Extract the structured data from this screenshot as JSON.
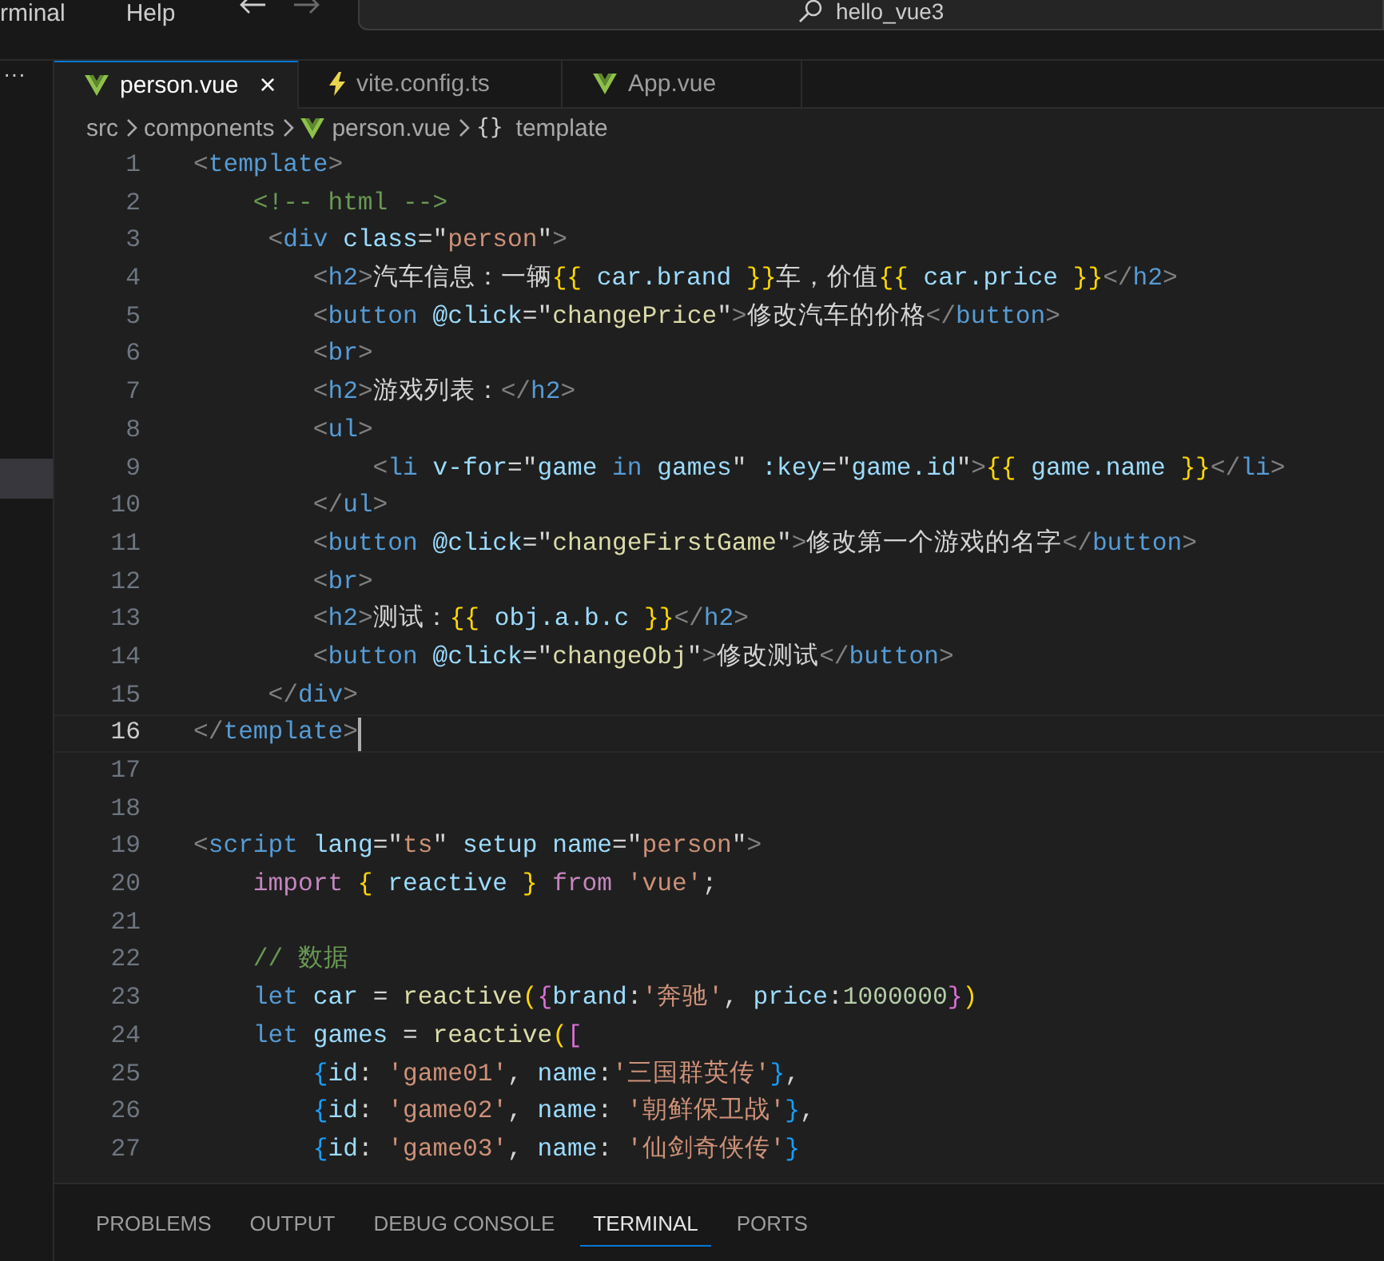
{
  "menu": [
    {
      "label": "rminal"
    },
    {
      "label": "Help"
    }
  ],
  "search": {
    "value": "hello_vue3"
  },
  "sidebar": {
    "more": "···"
  },
  "tabs": [
    {
      "label": "person.vue",
      "kind": "vue",
      "selected": true,
      "close": "×"
    },
    {
      "label": "vite.config.ts",
      "kind": "config",
      "selected": false
    },
    {
      "label": "App.vue",
      "kind": "vue",
      "selected": false
    }
  ],
  "breadcrumb": [
    {
      "label": "src"
    },
    {
      "label": "components"
    },
    {
      "label": "person.vue",
      "kind": "vue"
    },
    {
      "label": "template",
      "symbol": "{}"
    }
  ],
  "lines": [
    {
      "number": "1",
      "current": false,
      "tokens": [
        {
          "kind": "punct",
          "text": "<"
        },
        {
          "kind": "tag",
          "text": "template"
        },
        {
          "kind": "punct",
          "text": ">"
        }
      ]
    },
    {
      "number": "2",
      "current": false,
      "tokens": [
        {
          "kind": "comment",
          "text": "    <!-- html -->"
        }
      ]
    },
    {
      "number": "3",
      "current": false,
      "tokens": [
        {
          "kind": "punct",
          "text": "     <"
        },
        {
          "kind": "tag",
          "text": "div"
        },
        {
          "kind": "attr",
          "text": " class"
        },
        {
          "kind": "text",
          "text": "=\""
        },
        {
          "kind": "string",
          "text": "person"
        },
        {
          "kind": "text",
          "text": "\""
        },
        {
          "kind": "punct",
          "text": ">"
        }
      ]
    },
    {
      "number": "4",
      "current": false,
      "tokens": [
        {
          "kind": "punct",
          "text": "        <"
        },
        {
          "kind": "tag",
          "text": "h2"
        },
        {
          "kind": "punct",
          "text": ">"
        },
        {
          "kind": "text",
          "text": "汽车信息：一辆"
        },
        {
          "kind": "brace",
          "text": "{{"
        },
        {
          "kind": "var",
          "text": " car.brand "
        },
        {
          "kind": "brace",
          "text": "}}"
        },
        {
          "kind": "text",
          "text": "车，价值"
        },
        {
          "kind": "brace",
          "text": "{{"
        },
        {
          "kind": "var",
          "text": " car.price "
        },
        {
          "kind": "brace",
          "text": "}}"
        },
        {
          "kind": "punct",
          "text": "</"
        },
        {
          "kind": "tag",
          "text": "h2"
        },
        {
          "kind": "punct",
          "text": ">"
        }
      ]
    },
    {
      "number": "5",
      "current": false,
      "tokens": [
        {
          "kind": "punct",
          "text": "        <"
        },
        {
          "kind": "tag",
          "text": "button"
        },
        {
          "kind": "attr",
          "text": " @click"
        },
        {
          "kind": "text",
          "text": "=\""
        },
        {
          "kind": "function",
          "text": "changePrice"
        },
        {
          "kind": "text",
          "text": "\""
        },
        {
          "kind": "punct",
          "text": ">"
        },
        {
          "kind": "text",
          "text": "修改汽车的价格"
        },
        {
          "kind": "punct",
          "text": "</"
        },
        {
          "kind": "tag",
          "text": "button"
        },
        {
          "kind": "punct",
          "text": ">"
        }
      ]
    },
    {
      "number": "6",
      "current": false,
      "tokens": [
        {
          "kind": "punct",
          "text": "        <"
        },
        {
          "kind": "tag",
          "text": "br"
        },
        {
          "kind": "punct",
          "text": ">"
        }
      ]
    },
    {
      "number": "7",
      "current": false,
      "tokens": [
        {
          "kind": "punct",
          "text": "        <"
        },
        {
          "kind": "tag",
          "text": "h2"
        },
        {
          "kind": "punct",
          "text": ">"
        },
        {
          "kind": "text",
          "text": "游戏列表："
        },
        {
          "kind": "punct",
          "text": "</"
        },
        {
          "kind": "tag",
          "text": "h2"
        },
        {
          "kind": "punct",
          "text": ">"
        }
      ]
    },
    {
      "number": "8",
      "current": false,
      "tokens": [
        {
          "kind": "punct",
          "text": "        <"
        },
        {
          "kind": "tag",
          "text": "ul"
        },
        {
          "kind": "punct",
          "text": ">"
        }
      ]
    },
    {
      "number": "9",
      "current": false,
      "tokens": [
        {
          "kind": "punct",
          "text": "            <"
        },
        {
          "kind": "tag",
          "text": "li"
        },
        {
          "kind": "attr",
          "text": " v-for"
        },
        {
          "kind": "text",
          "text": "=\""
        },
        {
          "kind": "var",
          "text": "game "
        },
        {
          "kind": "tag",
          "text": "in"
        },
        {
          "kind": "var",
          "text": " games"
        },
        {
          "kind": "text",
          "text": "\""
        },
        {
          "kind": "attr",
          "text": " :key"
        },
        {
          "kind": "text",
          "text": "=\""
        },
        {
          "kind": "var",
          "text": "game.id"
        },
        {
          "kind": "text",
          "text": "\""
        },
        {
          "kind": "punct",
          "text": ">"
        },
        {
          "kind": "brace",
          "text": "{{"
        },
        {
          "kind": "var",
          "text": " game.name "
        },
        {
          "kind": "brace",
          "text": "}}"
        },
        {
          "kind": "punct",
          "text": "</"
        },
        {
          "kind": "tag",
          "text": "li"
        },
        {
          "kind": "punct",
          "text": ">"
        }
      ]
    },
    {
      "number": "10",
      "current": false,
      "tokens": [
        {
          "kind": "punct",
          "text": "        </"
        },
        {
          "kind": "tag",
          "text": "ul"
        },
        {
          "kind": "punct",
          "text": ">"
        }
      ]
    },
    {
      "number": "11",
      "current": false,
      "tokens": [
        {
          "kind": "punct",
          "text": "        <"
        },
        {
          "kind": "tag",
          "text": "button"
        },
        {
          "kind": "attr",
          "text": " @click"
        },
        {
          "kind": "text",
          "text": "=\""
        },
        {
          "kind": "function",
          "text": "changeFirstGame"
        },
        {
          "kind": "text",
          "text": "\""
        },
        {
          "kind": "punct",
          "text": ">"
        },
        {
          "kind": "text",
          "text": "修改第一个游戏的名字"
        },
        {
          "kind": "punct",
          "text": "</"
        },
        {
          "kind": "tag",
          "text": "button"
        },
        {
          "kind": "punct",
          "text": ">"
        }
      ]
    },
    {
      "number": "12",
      "current": false,
      "tokens": [
        {
          "kind": "punct",
          "text": "        <"
        },
        {
          "kind": "tag",
          "text": "br"
        },
        {
          "kind": "punct",
          "text": ">"
        }
      ]
    },
    {
      "number": "13",
      "current": false,
      "tokens": [
        {
          "kind": "punct",
          "text": "        <"
        },
        {
          "kind": "tag",
          "text": "h2"
        },
        {
          "kind": "punct",
          "text": ">"
        },
        {
          "kind": "text",
          "text": "测试："
        },
        {
          "kind": "brace",
          "text": "{{"
        },
        {
          "kind": "var",
          "text": " obj.a.b.c "
        },
        {
          "kind": "brace",
          "text": "}}"
        },
        {
          "kind": "punct",
          "text": "</"
        },
        {
          "kind": "tag",
          "text": "h2"
        },
        {
          "kind": "punct",
          "text": ">"
        }
      ]
    },
    {
      "number": "14",
      "current": false,
      "tokens": [
        {
          "kind": "punct",
          "text": "        <"
        },
        {
          "kind": "tag",
          "text": "button"
        },
        {
          "kind": "attr",
          "text": " @click"
        },
        {
          "kind": "text",
          "text": "=\""
        },
        {
          "kind": "function",
          "text": "changeObj"
        },
        {
          "kind": "text",
          "text": "\""
        },
        {
          "kind": "punct",
          "text": ">"
        },
        {
          "kind": "text",
          "text": "修改测试"
        },
        {
          "kind": "punct",
          "text": "</"
        },
        {
          "kind": "tag",
          "text": "button"
        },
        {
          "kind": "punct",
          "text": ">"
        }
      ]
    },
    {
      "number": "15",
      "current": false,
      "tokens": [
        {
          "kind": "punct",
          "text": "     </"
        },
        {
          "kind": "tag",
          "text": "div"
        },
        {
          "kind": "punct",
          "text": ">"
        }
      ]
    },
    {
      "number": "16",
      "current": true,
      "tokens": [
        {
          "kind": "punct",
          "text": "</"
        },
        {
          "kind": "tag",
          "text": "template"
        },
        {
          "kind": "punct",
          "text": ">"
        }
      ]
    },
    {
      "number": "17",
      "current": false
    },
    {
      "number": "18",
      "current": false
    },
    {
      "number": "19",
      "current": false,
      "tokens": [
        {
          "kind": "punct",
          "text": "<"
        },
        {
          "kind": "tag",
          "text": "script"
        },
        {
          "kind": "attr",
          "text": " lang"
        },
        {
          "kind": "text",
          "text": "=\""
        },
        {
          "kind": "string",
          "text": "ts"
        },
        {
          "kind": "text",
          "text": "\""
        },
        {
          "kind": "attr",
          "text": " setup name"
        },
        {
          "kind": "text",
          "text": "=\""
        },
        {
          "kind": "string",
          "text": "person"
        },
        {
          "kind": "text",
          "text": "\""
        },
        {
          "kind": "punct",
          "text": ">"
        }
      ]
    },
    {
      "number": "20",
      "current": false,
      "tokens": [
        {
          "kind": "keyword",
          "text": "    import"
        },
        {
          "kind": "brace",
          "text": " {"
        },
        {
          "kind": "var",
          "text": " reactive "
        },
        {
          "kind": "brace",
          "text": "}"
        },
        {
          "kind": "keyword",
          "text": " from"
        },
        {
          "kind": "string",
          "text": " 'vue'"
        },
        {
          "kind": "text",
          "text": ";"
        }
      ]
    },
    {
      "number": "21",
      "current": false
    },
    {
      "number": "22",
      "current": false,
      "tokens": [
        {
          "kind": "comment",
          "text": "    // 数据"
        }
      ]
    },
    {
      "number": "23",
      "current": false,
      "tokens": [
        {
          "kind": "storage",
          "text": "    let"
        },
        {
          "kind": "var",
          "text": " car "
        },
        {
          "kind": "text",
          "text": "= "
        },
        {
          "kind": "function",
          "text": "reactive"
        },
        {
          "kind": "brace",
          "text": "("
        },
        {
          "kind": "bracket2",
          "text": "{"
        },
        {
          "kind": "var",
          "text": "brand"
        },
        {
          "kind": "text",
          "text": ":"
        },
        {
          "kind": "string",
          "text": "'奔驰'"
        },
        {
          "kind": "text",
          "text": ", "
        },
        {
          "kind": "var",
          "text": "price"
        },
        {
          "kind": "text",
          "text": ":"
        },
        {
          "kind": "number",
          "text": "1000000"
        },
        {
          "kind": "bracket2",
          "text": "}"
        },
        {
          "kind": "brace",
          "text": ")"
        }
      ]
    },
    {
      "number": "24",
      "current": false,
      "tokens": [
        {
          "kind": "storage",
          "text": "    let"
        },
        {
          "kind": "var",
          "text": " games "
        },
        {
          "kind": "text",
          "text": "= "
        },
        {
          "kind": "function",
          "text": "reactive"
        },
        {
          "kind": "brace",
          "text": "("
        },
        {
          "kind": "bracket2",
          "text": "["
        }
      ]
    },
    {
      "number": "25",
      "current": false,
      "tokens": [
        {
          "kind": "bracket3",
          "text": "        {"
        },
        {
          "kind": "var",
          "text": "id"
        },
        {
          "kind": "text",
          "text": ": "
        },
        {
          "kind": "string",
          "text": "'game01'"
        },
        {
          "kind": "text",
          "text": ", "
        },
        {
          "kind": "var",
          "text": "name"
        },
        {
          "kind": "text",
          "text": ":"
        },
        {
          "kind": "string",
          "text": "'三国群英传'"
        },
        {
          "kind": "bracket3",
          "text": "}"
        },
        {
          "kind": "text",
          "text": ","
        }
      ]
    },
    {
      "number": "26",
      "current": false,
      "tokens": [
        {
          "kind": "bracket3",
          "text": "        {"
        },
        {
          "kind": "var",
          "text": "id"
        },
        {
          "kind": "text",
          "text": ": "
        },
        {
          "kind": "string",
          "text": "'game02'"
        },
        {
          "kind": "text",
          "text": ", "
        },
        {
          "kind": "var",
          "text": "name"
        },
        {
          "kind": "text",
          "text": ": "
        },
        {
          "kind": "string",
          "text": "'朝鲜保卫战'"
        },
        {
          "kind": "bracket3",
          "text": "}"
        },
        {
          "kind": "text",
          "text": ","
        }
      ]
    },
    {
      "number": "27",
      "current": false,
      "tokens": [
        {
          "kind": "bracket3",
          "text": "        {"
        },
        {
          "kind": "var",
          "text": "id"
        },
        {
          "kind": "text",
          "text": ": "
        },
        {
          "kind": "string",
          "text": "'game03'"
        },
        {
          "kind": "text",
          "text": ", "
        },
        {
          "kind": "var",
          "text": "name"
        },
        {
          "kind": "text",
          "text": ": "
        },
        {
          "kind": "string",
          "text": "'仙剑奇侠传'"
        },
        {
          "kind": "bracket3",
          "text": "}"
        }
      ]
    }
  ],
  "panel_tabs": [
    {
      "label": "PROBLEMS",
      "selected": false
    },
    {
      "label": "OUTPUT",
      "selected": false
    },
    {
      "label": "DEBUG CONSOLE",
      "selected": false
    },
    {
      "label": "TERMINAL",
      "selected": true
    },
    {
      "label": "PORTS",
      "selected": false
    }
  ]
}
